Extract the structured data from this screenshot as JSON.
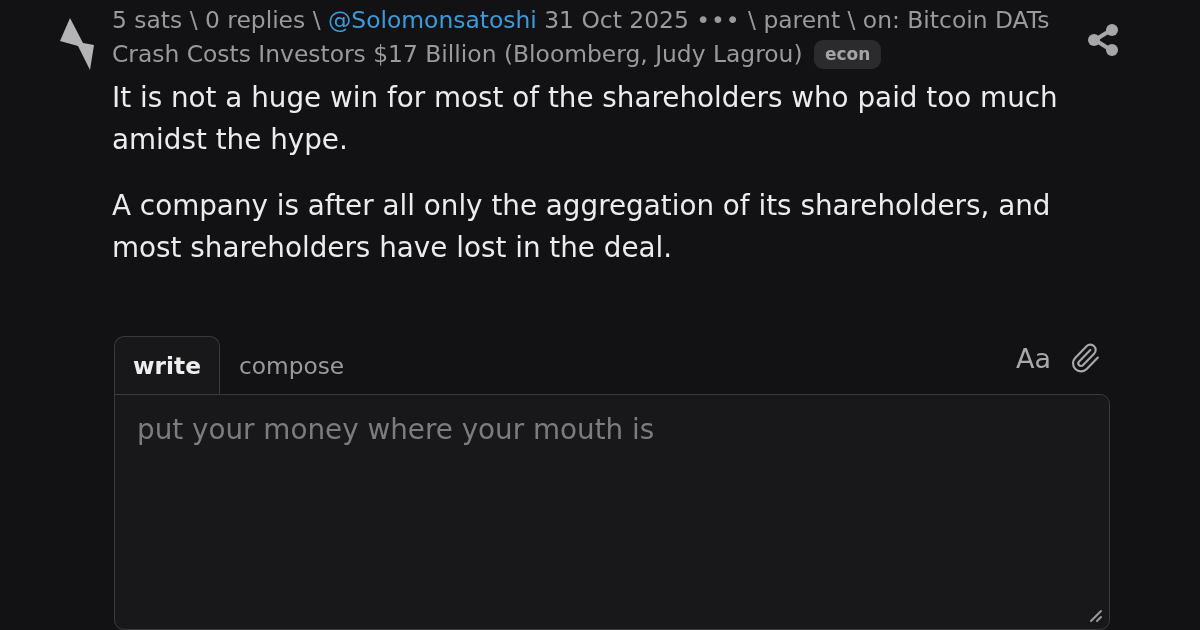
{
  "item": {
    "meta": [
      {
        "kind": "text",
        "text": "5 sats"
      },
      {
        "kind": "separator",
        "text": "\\"
      },
      {
        "kind": "replies",
        "text": "0 replies"
      },
      {
        "kind": "separator",
        "text": "\\"
      },
      {
        "kind": "author",
        "text": "@Solomonsatoshi"
      },
      {
        "kind": "date",
        "text": "31 Oct 2025"
      },
      {
        "kind": "menu",
        "text": "•••"
      },
      {
        "kind": "separator",
        "text": "\\"
      },
      {
        "kind": "parent",
        "text": "parent"
      },
      {
        "kind": "separator",
        "text": "\\"
      },
      {
        "kind": "text",
        "text": "on:"
      },
      {
        "kind": "title",
        "text": "Bitcoin DATs"
      },
      {
        "kind": "title",
        "text": "Crash Costs Investors $17 Billion (Bloomberg, Judy Lagrou)"
      },
      {
        "kind": "tag",
        "text": "econ"
      }
    ],
    "body": [
      "It is not a huge win for most of the shareholders who paid too much amidst the hype.",
      "A company is after all only the aggregation of its shareholders, and most shareholders have lost in the deal."
    ]
  },
  "reply_form": {
    "tabs": [
      {
        "label": "write",
        "selected": true
      },
      {
        "label": "compose",
        "selected": false
      }
    ],
    "format_toggle": "Aa",
    "textarea": {
      "placeholder": "put your money where your mouth is"
    }
  }
}
